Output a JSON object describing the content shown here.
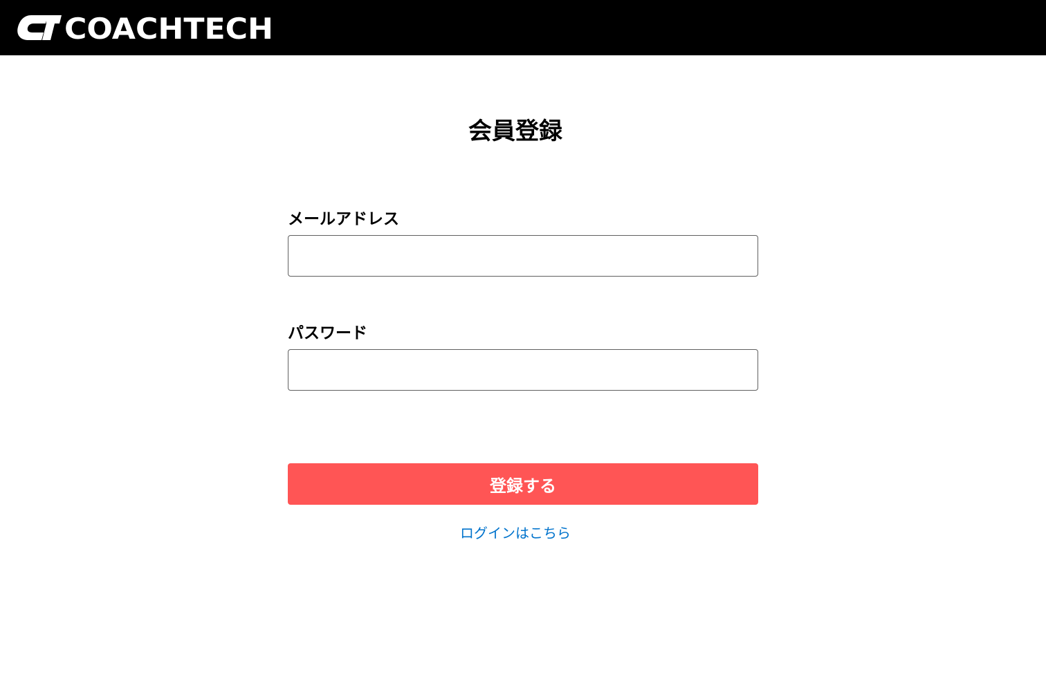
{
  "header": {
    "logo_text": "COACHTECH",
    "background_color": "#000000"
  },
  "form": {
    "title": "会員登録",
    "email_label": "メールアドレス",
    "email_value": "",
    "password_label": "パスワード",
    "password_value": "",
    "submit_label": "登録する",
    "submit_color": "#ff5555",
    "login_link_text": "ログインはこちら",
    "link_color": "#0073cc"
  }
}
